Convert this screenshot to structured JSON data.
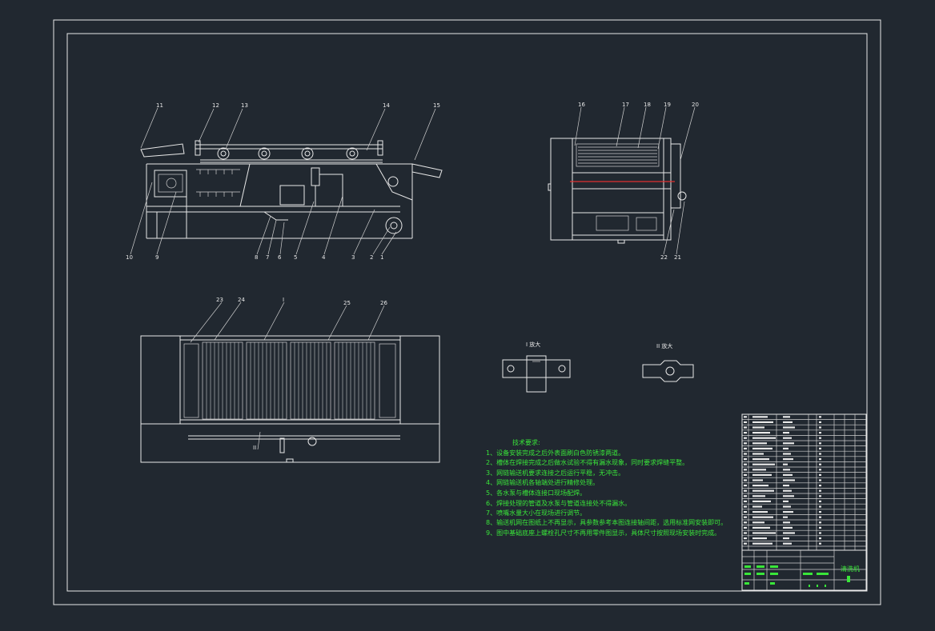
{
  "drawing": {
    "part_labels_side": [
      "11",
      "12",
      "13",
      "14",
      "15",
      "10",
      "9",
      "8",
      "7",
      "6",
      "5",
      "4",
      "3",
      "2",
      "1"
    ],
    "part_labels_end": [
      "16",
      "17",
      "18",
      "19",
      "20",
      "22",
      "21"
    ],
    "part_labels_top": [
      "23",
      "24",
      "I",
      "25",
      "26"
    ],
    "section_label": "II",
    "detail_labels": [
      "I 放大",
      "II 放大"
    ],
    "colors": {
      "background": "#212830",
      "lines": "#e8e8e8",
      "notes": "#39e639",
      "accent": "#e03030"
    }
  },
  "notes": {
    "title": "技术要求:",
    "items": [
      "1、设备安装完成之后外表面刷白色防锈漆两道。",
      "2、槽体在焊接完成之后做水试验不得有漏水现象，同时要求焊缝平整。",
      "3、网链输送机要求连接之后运行平稳，无冲击。",
      "4、网链输送机各轴端处进行精修处理。",
      "5、各水泵与槽体连接口现场配焊。",
      "6、焊接处理的管道及水泵与管道连接处不得漏水。",
      "7、喷嘴水量大小在现场进行调节。",
      "8、输送机网在图纸上不再显示，具参数参考本图连接轴间距，选用标准网安装即可。",
      "9、图中基础底座上螺栓孔尺寸不再用零件图显示，具体尺寸按照现场安装时完成。"
    ]
  },
  "title_block": {
    "drawing_name": "清洗机"
  }
}
